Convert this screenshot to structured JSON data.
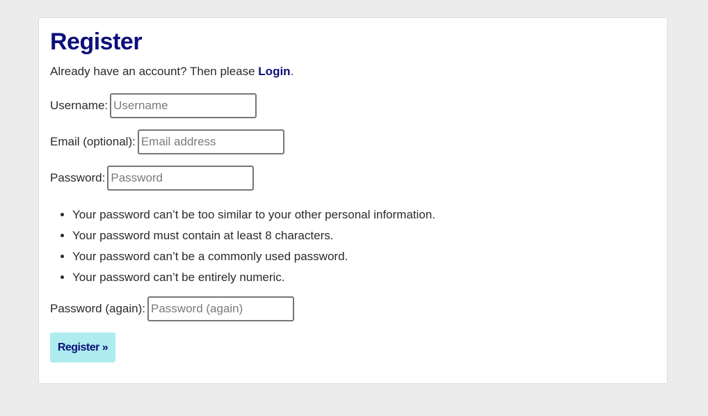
{
  "page": {
    "title": "Register"
  },
  "intro": {
    "text": "Already have an account? Then please ",
    "login_link": "Login",
    "suffix": "."
  },
  "form": {
    "username": {
      "label": "Username:",
      "placeholder": "Username",
      "value": ""
    },
    "email": {
      "label": "Email (optional):",
      "placeholder": "Email address",
      "value": ""
    },
    "password": {
      "label": "Password:",
      "placeholder": "Password",
      "value": ""
    },
    "password_hints": [
      "Your password can’t be too similar to your other personal information.",
      "Your password must contain at least 8 characters.",
      "Your password can’t be a commonly used password.",
      "Your password can’t be entirely numeric."
    ],
    "password_again": {
      "label": "Password (again):",
      "placeholder": "Password (again)",
      "value": ""
    },
    "submit_label": "Register »"
  },
  "colors": {
    "accent": "#0b0f7a",
    "button_bg": "#aeecef",
    "page_bg": "#ececec"
  }
}
